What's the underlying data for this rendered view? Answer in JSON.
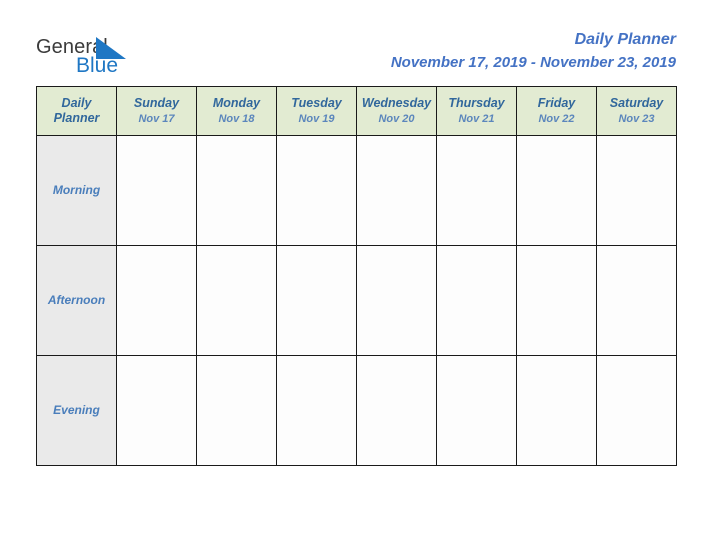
{
  "brand": {
    "name_part1": "General",
    "name_part2": "Blue",
    "logo_icon": "blue-triangle-icon",
    "accent_color": "#1f77c4"
  },
  "header": {
    "title": "Daily Planner",
    "date_range": "November 17, 2019 - November 23, 2019",
    "title_color": "#4472c4"
  },
  "table": {
    "corner_label_line1": "Daily",
    "corner_label_line2": "Planner",
    "header_bg_color": "#e2ebd2",
    "row_label_bg_color": "#eaeaea",
    "columns": [
      {
        "day": "Sunday",
        "date": "Nov 17"
      },
      {
        "day": "Monday",
        "date": "Nov 18"
      },
      {
        "day": "Tuesday",
        "date": "Nov 19"
      },
      {
        "day": "Wednesday",
        "date": "Nov 20"
      },
      {
        "day": "Thursday",
        "date": "Nov 21"
      },
      {
        "day": "Friday",
        "date": "Nov 22"
      },
      {
        "day": "Saturday",
        "date": "Nov 23"
      }
    ],
    "rows": [
      {
        "label": "Morning",
        "cells": [
          "",
          "",
          "",
          "",
          "",
          "",
          ""
        ]
      },
      {
        "label": "Afternoon",
        "cells": [
          "",
          "",
          "",
          "",
          "",
          "",
          ""
        ]
      },
      {
        "label": "Evening",
        "cells": [
          "",
          "",
          "",
          "",
          "",
          "",
          ""
        ]
      }
    ]
  }
}
